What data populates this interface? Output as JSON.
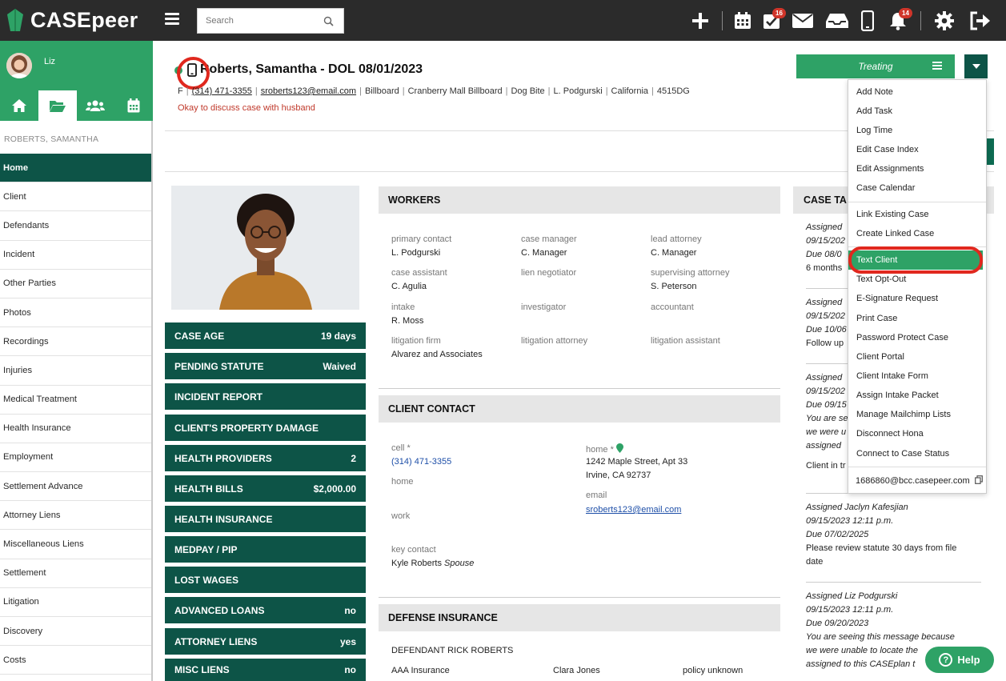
{
  "app": {
    "logo_text": "CASEpeer"
  },
  "topbar": {
    "search_placeholder": "Search",
    "tasks_badge": "16",
    "notifications_badge": "14"
  },
  "sidebar": {
    "user_name": "Liz",
    "case_name": "ROBERTS, SAMANTHA",
    "items": [
      {
        "label": "Home"
      },
      {
        "label": "Client"
      },
      {
        "label": "Defendants"
      },
      {
        "label": "Incident"
      },
      {
        "label": "Other Parties"
      },
      {
        "label": "Photos"
      },
      {
        "label": "Recordings"
      },
      {
        "label": "Injuries"
      },
      {
        "label": "Medical Treatment"
      },
      {
        "label": "Health Insurance"
      },
      {
        "label": "Employment"
      },
      {
        "label": "Settlement Advance"
      },
      {
        "label": "Attorney Liens"
      },
      {
        "label": "Miscellaneous Liens"
      },
      {
        "label": "Settlement"
      },
      {
        "label": "Litigation"
      },
      {
        "label": "Discovery"
      },
      {
        "label": "Costs"
      }
    ],
    "active_index": 0
  },
  "case": {
    "title": "Roberts, Samantha - DOL 08/01/2023",
    "gender": "F",
    "phone": "(314) 471-3355",
    "email": "sroberts123@email.com",
    "tags": [
      "Billboard",
      "Cranberry Mall Billboard",
      "Dog Bite",
      "L. Podgurski",
      "California",
      "4515DG"
    ],
    "note": "Okay to discuss case with husband",
    "status": "Treating"
  },
  "menu": {
    "items": [
      {
        "label": "Add Note"
      },
      {
        "label": "Add Task"
      },
      {
        "label": "Log Time"
      },
      {
        "label": "Edit Case Index"
      },
      {
        "label": "Edit Assignments"
      },
      {
        "label": "Case Calendar"
      },
      {
        "label": "Link Existing Case"
      },
      {
        "label": "Create Linked Case"
      },
      {
        "label": "Text Client"
      },
      {
        "label": "Text Opt-Out"
      },
      {
        "label": "E-Signature Request"
      },
      {
        "label": "Print Case"
      },
      {
        "label": "Password Protect Case"
      },
      {
        "label": "Client Portal"
      },
      {
        "label": "Client Intake Form"
      },
      {
        "label": "Assign Intake Packet"
      },
      {
        "label": "Manage Mailchimp Lists"
      },
      {
        "label": "Disconnect Hona"
      },
      {
        "label": "Connect to Case Status"
      }
    ],
    "highlighted_index": 8,
    "case_email": "1686860@bcc.casepeer.com"
  },
  "tiles": [
    {
      "label": "CASE AGE",
      "value": "19 days"
    },
    {
      "label": "PENDING STATUTE",
      "value": "Waived"
    },
    {
      "label": "INCIDENT REPORT",
      "value": ""
    },
    {
      "label": "CLIENT'S PROPERTY DAMAGE",
      "value": ""
    },
    {
      "label": "HEALTH PROVIDERS",
      "value": "2"
    },
    {
      "label": "HEALTH BILLS",
      "value": "$2,000.00"
    },
    {
      "label": "HEALTH INSURANCE",
      "value": ""
    },
    {
      "label": "MEDPAY / PIP",
      "value": ""
    },
    {
      "label": "LOST WAGES",
      "value": ""
    },
    {
      "label": "ADVANCED LOANS",
      "value": "no"
    },
    {
      "label": "ATTORNEY LIENS",
      "value": "yes"
    },
    {
      "label": "MISC LIENS",
      "value": "no"
    }
  ],
  "workers": {
    "title": "WORKERS",
    "fields": [
      {
        "label": "primary contact",
        "value": "L. Podgurski"
      },
      {
        "label": "case manager",
        "value": "C. Manager"
      },
      {
        "label": "lead attorney",
        "value": "C. Manager"
      },
      {
        "label": "case assistant",
        "value": "C. Agulia"
      },
      {
        "label": "lien negotiator",
        "value": ""
      },
      {
        "label": "supervising attorney",
        "value": "S. Peterson"
      },
      {
        "label": "intake",
        "value": "R. Moss"
      },
      {
        "label": "investigator",
        "value": ""
      },
      {
        "label": "accountant",
        "value": ""
      },
      {
        "label": "litigation firm",
        "value": "Alvarez and Associates"
      },
      {
        "label": "litigation attorney",
        "value": ""
      },
      {
        "label": "litigation assistant",
        "value": ""
      }
    ]
  },
  "client_contact": {
    "title": "CLIENT CONTACT",
    "cell_label": "cell *",
    "cell_value": "(314) 471-3355",
    "home_label": "home",
    "work_label": "work",
    "key_contact_label": "key contact",
    "key_contact_name": "Kyle Roberts",
    "key_contact_relation": "Spouse",
    "home_addr_label": "home *",
    "address_line1": "1242 Maple Street, Apt 33",
    "address_line2": "Irvine, CA 92737",
    "email_label": "email",
    "email_value": "sroberts123@email.com"
  },
  "defense": {
    "title": "DEFENSE INSURANCE",
    "defendant": "DEFENDANT RICK ROBERTS",
    "insurer": "AAA Insurance",
    "adjuster": "Clara Jones",
    "policy": "policy unknown"
  },
  "tasks": {
    "title": "CASE TA",
    "t1": {
      "l1": "Assigned",
      "l2": "09/15/202",
      "l3": "Due 08/0",
      "l4": "6 months"
    },
    "t2": {
      "l1": "Assigned",
      "l2": "09/15/202",
      "l3": "Due 10/06",
      "l4": "Follow up"
    },
    "t3": {
      "l1": "Assigned",
      "l2": "09/15/202",
      "l3": "Due 09/15",
      "l4": "You are se",
      "l5": "we were u",
      "l6": "assigned",
      "l7": "Client in tr"
    },
    "t4": {
      "l1": "Assigned Jaclyn Kafesjian",
      "l2": "09/15/2023 12:11 p.m.",
      "l3": "Due 07/02/2025",
      "l4": "Please review statute 30 days from file",
      "l5": "date"
    },
    "t5": {
      "l1": "Assigned Liz Podgurski",
      "l2": "09/15/2023 12:11 p.m.",
      "l3": "Due 09/20/2023",
      "l4": "You are seeing this message because",
      "l5": "we were unable to locate the",
      "l6": "assigned to this CASEplan t"
    }
  },
  "help": {
    "label": "Help"
  },
  "colors": {
    "brand_green": "#2ea266",
    "dark_teal": "#0d5447",
    "topbar": "#2b2b2b",
    "annotation_red": "#e0281e"
  }
}
